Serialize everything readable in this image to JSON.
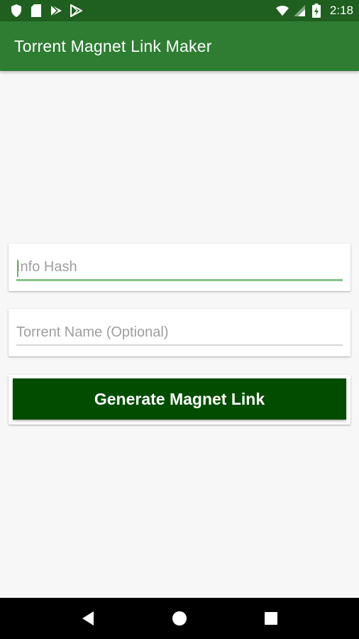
{
  "status_bar": {
    "time": "2:18",
    "left_icons": [
      "shield-icon",
      "sd-card-icon",
      "play-store-icon",
      "play-store-outline-icon"
    ],
    "right_icons": [
      "wifi-icon",
      "signal-icon",
      "battery-icon"
    ]
  },
  "app_bar": {
    "title": "Torrent Magnet Link Maker",
    "color": "#2e7d32"
  },
  "form": {
    "info_hash": {
      "placeholder": "Info Hash",
      "value": ""
    },
    "torrent_name": {
      "placeholder": "Torrent Name (Optional)",
      "value": ""
    },
    "generate_label": "Generate Magnet Link",
    "button_color": "#004d00"
  },
  "nav_bar": {
    "buttons": [
      "back-icon",
      "home-icon",
      "recents-icon"
    ]
  }
}
